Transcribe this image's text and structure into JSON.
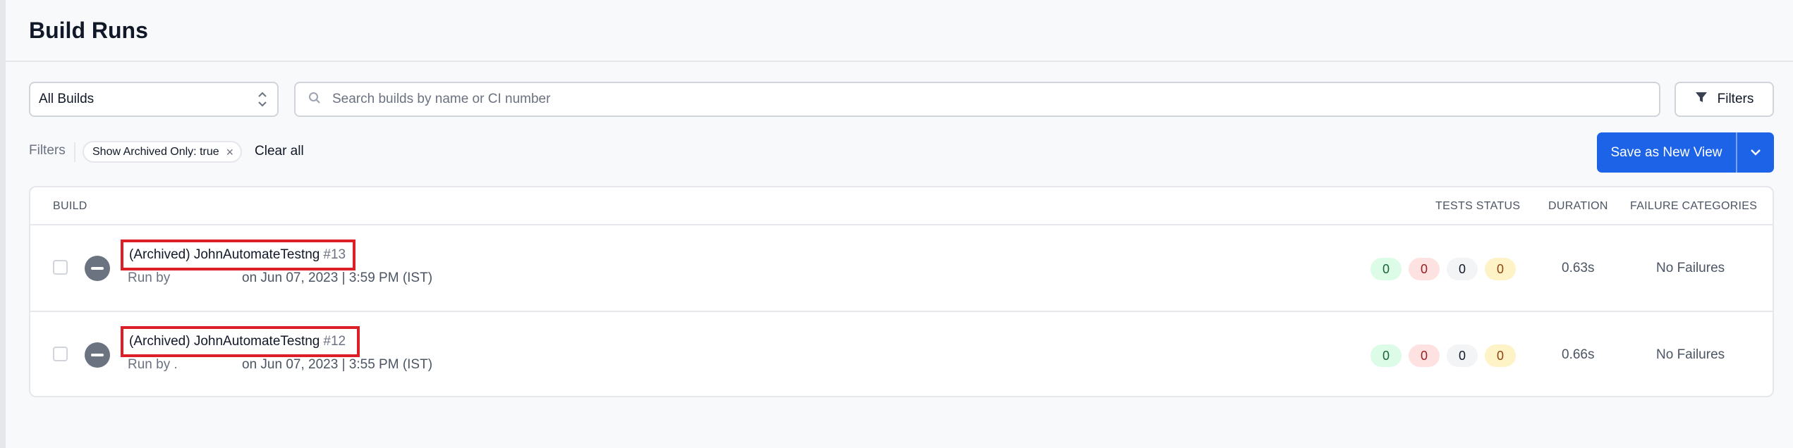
{
  "header": {
    "title": "Build Runs"
  },
  "toolbar": {
    "select_value": "All Builds",
    "search_placeholder": "Search builds by name or CI number",
    "filters_label": "Filters"
  },
  "filter_bar": {
    "label": "Filters",
    "chip_label": "Show Archived Only: true",
    "chip_remove": "×",
    "clear_all": "Clear all",
    "save_view_label": "Save as New View"
  },
  "table": {
    "columns": {
      "build": "BUILD",
      "tests_status": "TESTS STATUS",
      "duration": "DURATION",
      "failure_categories": "FAILURE CATEGORIES"
    },
    "rows": [
      {
        "name": "(Archived) JohnAutomateTestng",
        "number": "#13",
        "run_by": "Run by",
        "date": "on Jun 07, 2023 | 3:59 PM (IST)",
        "tests": {
          "passed": "0",
          "failed": "0",
          "skipped": "0",
          "other": "0"
        },
        "duration": "0.63s",
        "failures": "No Failures"
      },
      {
        "name": "(Archived) JohnAutomateTestng",
        "number": "#12",
        "run_by": "Run by .",
        "date": "on Jun 07, 2023 | 3:55 PM (IST)",
        "tests": {
          "passed": "0",
          "failed": "0",
          "skipped": "0",
          "other": "0"
        },
        "duration": "0.66s",
        "failures": "No Failures"
      }
    ]
  },
  "icons": {
    "select": "chevron-up-down-icon",
    "search": "search-icon",
    "filter": "funnel-icon",
    "save_caret": "chevron-down-icon",
    "status": "minus-circle-icon"
  },
  "colors": {
    "primary": "#1d63e8",
    "highlight": "#dc1f26",
    "status_gray": "#6b7280"
  }
}
